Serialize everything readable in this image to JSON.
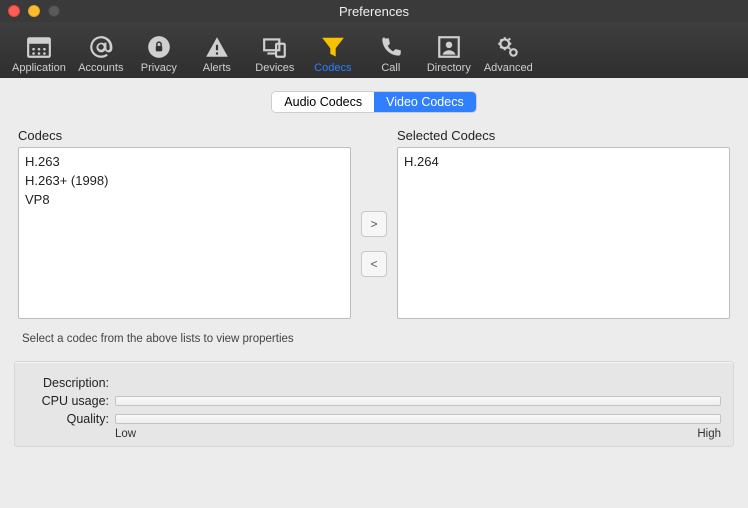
{
  "window": {
    "title": "Preferences"
  },
  "toolbar": {
    "items": [
      {
        "label": "Application"
      },
      {
        "label": "Accounts"
      },
      {
        "label": "Privacy"
      },
      {
        "label": "Alerts"
      },
      {
        "label": "Devices"
      },
      {
        "label": "Codecs"
      },
      {
        "label": "Call"
      },
      {
        "label": "Directory"
      },
      {
        "label": "Advanced"
      }
    ],
    "active_index": 5
  },
  "tabs": {
    "audio": "Audio Codecs",
    "video": "Video Codecs",
    "selected": "video"
  },
  "codecs": {
    "available_label": "Codecs",
    "selected_label": "Selected Codecs",
    "available": [
      "H.263",
      "H.263+ (1998)",
      "VP8"
    ],
    "selected": [
      "H.264"
    ]
  },
  "transfer": {
    "add": ">",
    "remove": "<"
  },
  "properties": {
    "hint": "Select a codec from the above lists to view properties",
    "description_label": "Description:",
    "cpu_label": "CPU usage:",
    "quality_label": "Quality:",
    "scale_low": "Low",
    "scale_high": "High"
  }
}
